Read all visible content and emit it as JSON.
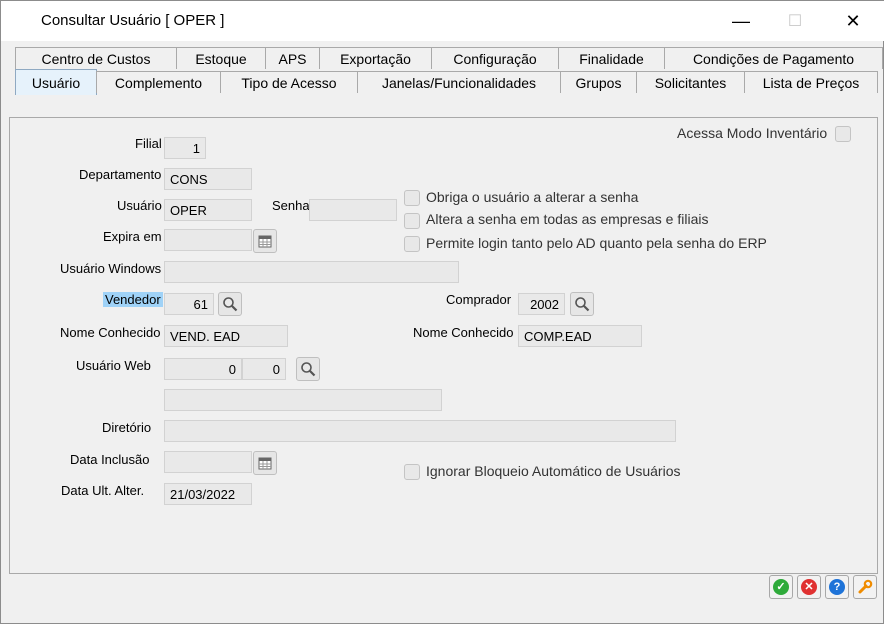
{
  "window": {
    "title": "Consultar Usuário [ OPER ]",
    "minimize": "—",
    "maximize": "☐",
    "close": "✕"
  },
  "tabs_top": [
    "Centro de Custos",
    "Estoque",
    "APS",
    "Exportação",
    "Configuração",
    "Finalidade",
    "Condições de Pagamento"
  ],
  "tabs_bottom": [
    "Usuário",
    "Complemento",
    "Tipo de Acesso",
    "Janelas/Funcionalidades",
    "Grupos",
    "Solicitantes",
    "Lista de Preços"
  ],
  "active_tab": "Usuário",
  "form": {
    "filial_label": "Filial",
    "filial_value": "1",
    "departamento_label": "Departamento",
    "departamento_value": "CONS",
    "usuario_label": "Usuário",
    "usuario_value": "OPER",
    "senha_label": "Senha",
    "senha_value": "",
    "expira_label": "Expira em",
    "expira_value": "",
    "usuario_windows_label": "Usuário Windows",
    "usuario_windows_value": "",
    "vendedor_label": "Vendedor",
    "vendedor_value": "61",
    "comprador_label": "Comprador",
    "comprador_value": "2002",
    "nome_conhecido_vend_label": "Nome Conhecido",
    "nome_conhecido_vend_value": "VEND. EAD",
    "nome_conhecido_comp_label": "Nome Conhecido",
    "nome_conhecido_comp_value": "COMP.EAD",
    "usuario_web_label": "Usuário Web",
    "usuario_web_value1": "0",
    "usuario_web_value2": "0",
    "usuario_web_extra_value": "",
    "diretorio_label": "Diretório",
    "diretorio_value": "",
    "data_inclusao_label": "Data Inclusão",
    "data_inclusao_value": "",
    "data_ult_alter_label": "Data Ult. Alter.",
    "data_ult_alter_value": "21/03/2022"
  },
  "checkboxes": {
    "acessa_inventario": "Acessa Modo Inventário",
    "obriga_alterar": "Obriga o usuário a alterar a senha",
    "altera_todas": "Altera a senha em todas as empresas e filiais",
    "permite_login": "Permite login tanto pelo AD quanto pela senha do ERP",
    "ignorar_bloqueio": "Ignorar Bloqueio Automático de Usuários"
  },
  "colors": {
    "highlight": "#9fd2f7",
    "ok": "#2eaa3a",
    "cancel": "#e03131",
    "help": "#1e73d8",
    "tools": "#f08c00"
  }
}
